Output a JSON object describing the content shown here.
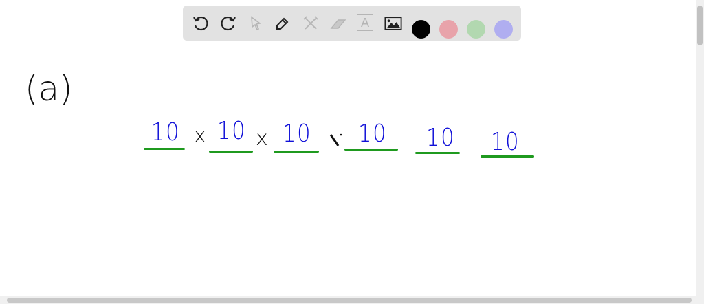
{
  "toolbar": {
    "tools": [
      "undo-icon",
      "redo-icon",
      "select-icon",
      "pen-icon",
      "tools-icon",
      "eraser-icon",
      "text-icon",
      "image-icon"
    ],
    "text_tool_glyph": "A",
    "colors": [
      "#000000",
      "#e8a3aa",
      "#b2d8b0",
      "#b0aef0"
    ]
  },
  "canvas": {
    "label": "(a)",
    "numbers": [
      "10",
      "10",
      "10",
      "10",
      "10",
      "10"
    ],
    "operators": [
      "x",
      "x"
    ],
    "stroke_color_numbers": "#1010d8",
    "stroke_color_lines": "#1f9a1f"
  }
}
